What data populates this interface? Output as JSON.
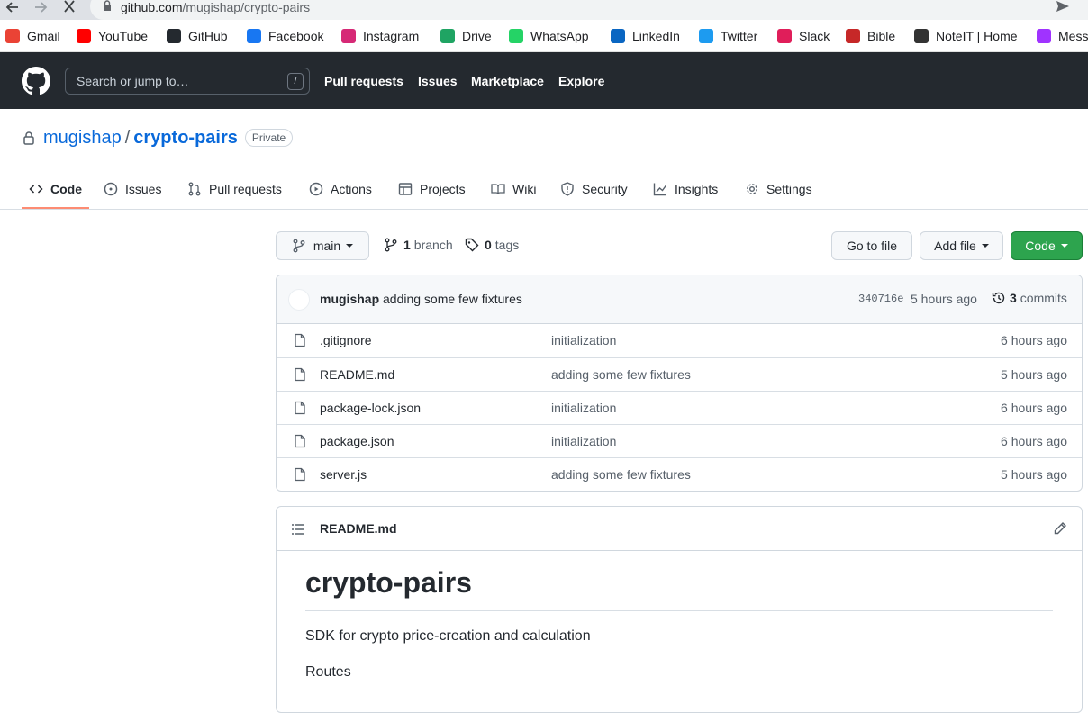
{
  "browser": {
    "url_host": "github.com",
    "url_path": "/mugishap/crypto-pairs",
    "bookmarks": [
      {
        "label": "Gmail",
        "icon": "gmail-icon",
        "color": "#ea4335"
      },
      {
        "label": "YouTube",
        "icon": "youtube-icon",
        "color": "#ff0000"
      },
      {
        "label": "GitHub",
        "icon": "github-icon",
        "color": "#24292f"
      },
      {
        "label": "Facebook",
        "icon": "facebook-icon",
        "color": "#1877f2"
      },
      {
        "label": "Instagram",
        "icon": "instagram-icon",
        "color": "#d62976"
      },
      {
        "label": "Drive",
        "icon": "drive-icon",
        "color": "#1fa463"
      },
      {
        "label": "WhatsApp",
        "icon": "whatsapp-icon",
        "color": "#25d366"
      },
      {
        "label": "LinkedIn",
        "icon": "linkedin-icon",
        "color": "#0a66c2"
      },
      {
        "label": "Twitter",
        "icon": "twitter-icon",
        "color": "#1d9bf0"
      },
      {
        "label": "Slack",
        "icon": "slack-icon",
        "color": "#e01e5a"
      },
      {
        "label": "Bible",
        "icon": "bible-icon",
        "color": "#c62828"
      },
      {
        "label": "NoteIT | Home",
        "icon": "noteit-icon",
        "color": "#333333"
      },
      {
        "label": "Mess",
        "icon": "messenger-icon",
        "color": "#a033ff"
      }
    ]
  },
  "header": {
    "search_placeholder": "Search or jump to…",
    "slash_key": "/",
    "nav": [
      "Pull requests",
      "Issues",
      "Marketplace",
      "Explore"
    ]
  },
  "repo": {
    "owner": "mugishap",
    "separator": "/",
    "name": "crypto-pairs",
    "visibility": "Private"
  },
  "tabs": [
    "Code",
    "Issues",
    "Pull requests",
    "Actions",
    "Projects",
    "Wiki",
    "Security",
    "Insights",
    "Settings"
  ],
  "filenav": {
    "branch": "main",
    "branch_count": "1",
    "branch_label": "branch",
    "tag_count": "0",
    "tag_label": "tags",
    "go_to_file": "Go to file",
    "add_file": "Add file",
    "code": "Code"
  },
  "commit": {
    "author": "mugishap",
    "message": "adding some few fixtures",
    "sha": "340716e",
    "age": "5 hours ago",
    "count": "3",
    "count_label": "commits"
  },
  "files": [
    {
      "name": ".gitignore",
      "message": "initialization",
      "age": "6 hours ago"
    },
    {
      "name": "README.md",
      "message": "adding some few fixtures",
      "age": "5 hours ago"
    },
    {
      "name": "package-lock.json",
      "message": "initialization",
      "age": "6 hours ago"
    },
    {
      "name": "package.json",
      "message": "initialization",
      "age": "6 hours ago"
    },
    {
      "name": "server.js",
      "message": "adding some few fixtures",
      "age": "5 hours ago"
    }
  ],
  "readme": {
    "file_title": "README.md",
    "heading": "crypto-pairs",
    "paragraph": "SDK for crypto price-creation and calculation",
    "routes": "Routes"
  }
}
